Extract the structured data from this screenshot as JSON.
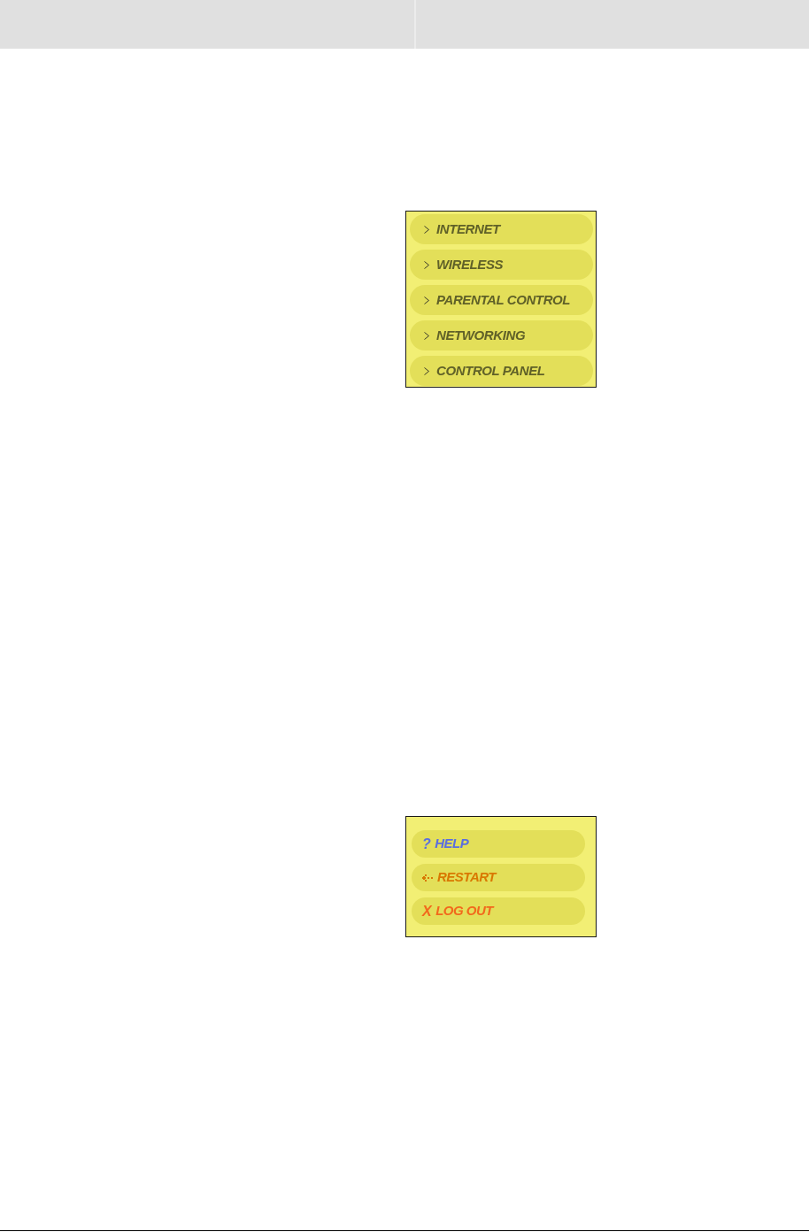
{
  "menu": {
    "items": [
      {
        "label": "INTERNET"
      },
      {
        "label": "WIRELESS"
      },
      {
        "label": "PARENTAL CONTROL"
      },
      {
        "label": "NETWORKING"
      },
      {
        "label": "CONTROL PANEL"
      }
    ]
  },
  "actions": {
    "items": [
      {
        "kind": "glyph",
        "glyph": "?",
        "label": "HELP",
        "color": "#5a6ee0"
      },
      {
        "kind": "arrow",
        "label": "RESTART",
        "color": "#d97800"
      },
      {
        "kind": "glyph",
        "glyph": "X",
        "label": "LOG OUT",
        "color": "#f2691c"
      }
    ]
  }
}
